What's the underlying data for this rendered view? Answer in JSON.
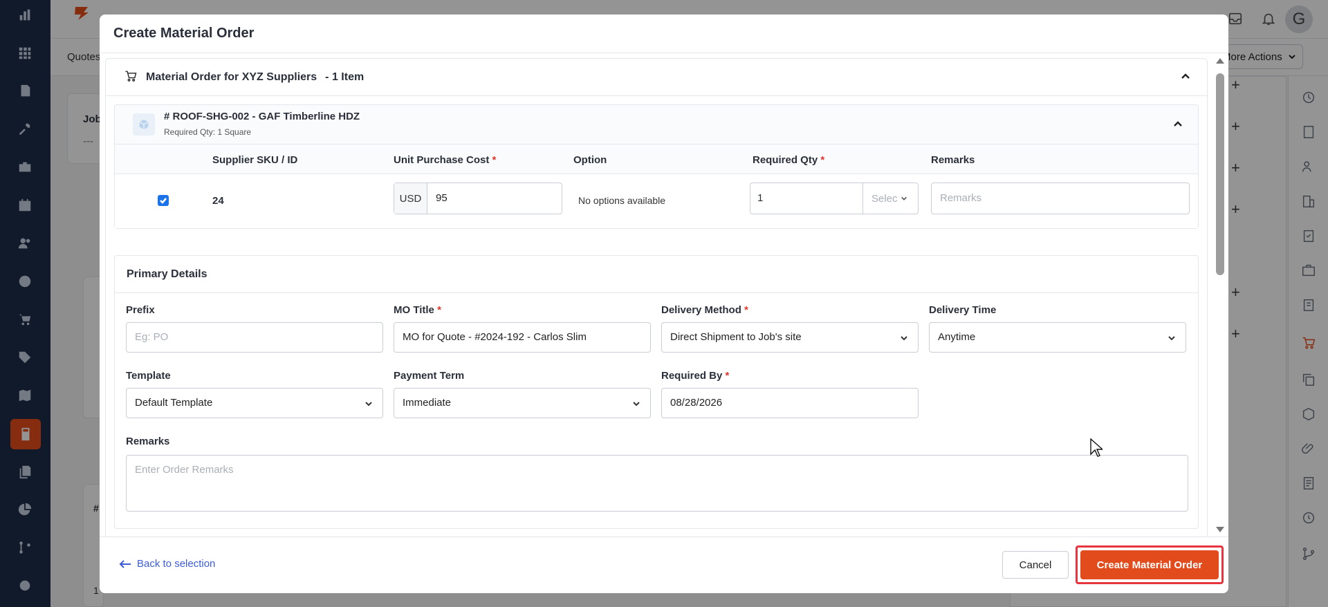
{
  "background": {
    "subnav_label": "Quotes",
    "more_actions_label": "More Actions",
    "avatar_initial": "G",
    "panel_fragment_1": "Job",
    "panel_fragment_2": "---",
    "table_fragment_hash": "#",
    "table_fragment_row": "1"
  },
  "modal": {
    "title": "Create Material Order",
    "supplier": {
      "title": "Material Order for XYZ Suppliers",
      "count": "- 1 Item"
    },
    "item": {
      "title": "# ROOF-SHG-002 - GAF Timberline HDZ",
      "subtitle": "Required Qty: 1 Square",
      "columns": {
        "sku": "Supplier SKU / ID",
        "cost": "Unit Purchase Cost",
        "option": "Option",
        "qty": "Required Qty",
        "remarks": "Remarks"
      },
      "row": {
        "sku": "24",
        "currency": "USD",
        "cost": "95",
        "option": "No options available",
        "qty": "1",
        "unit_placeholder": "Selec",
        "remarks_placeholder": "Remarks"
      }
    },
    "primary": {
      "title": "Primary Details",
      "prefix_label": "Prefix",
      "prefix_placeholder": "Eg: PO",
      "mo_title_label": "MO Title",
      "mo_title_value": "MO for Quote - #2024-192 - Carlos Slim",
      "delivery_method_label": "Delivery Method",
      "delivery_method_value": "Direct Shipment to Job's site",
      "delivery_time_label": "Delivery Time",
      "delivery_time_value": "Anytime",
      "template_label": "Template",
      "template_value": "Default Template",
      "payment_term_label": "Payment Term",
      "payment_term_value": "Immediate",
      "required_by_label": "Required By",
      "required_by_value": "08/28/2026",
      "remarks_label": "Remarks",
      "remarks_placeholder": "Enter Order Remarks"
    },
    "footer": {
      "back_label": "Back to selection",
      "cancel_label": "Cancel",
      "create_label": "Create Material Order"
    }
  },
  "required_marker": "*",
  "colors": {
    "brand": "#e24b1c",
    "nav": "#1e2e4a",
    "link": "#3b5bdb",
    "required": "#e0352b"
  }
}
